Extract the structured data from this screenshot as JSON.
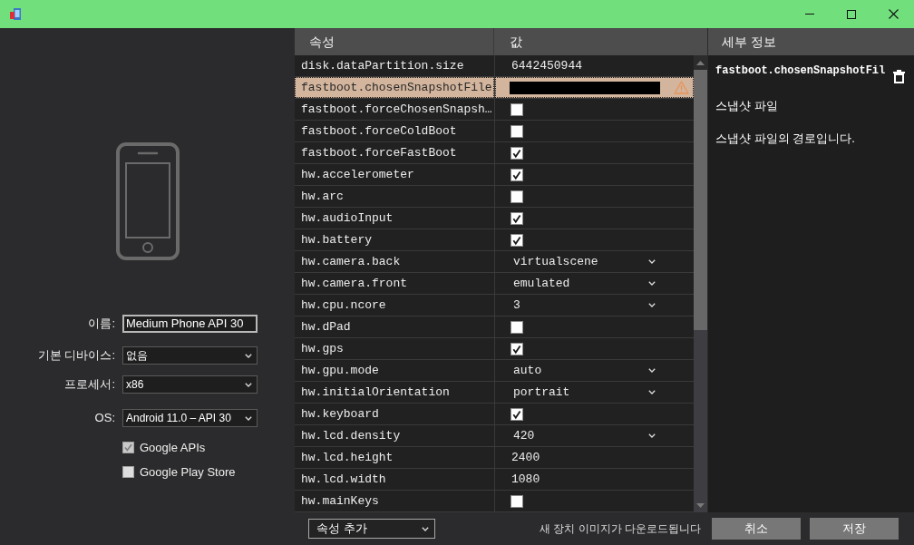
{
  "device_form": {
    "fields": [
      {
        "kind": "text",
        "label": "이름:",
        "value": "Medium Phone API 30"
      },
      {
        "kind": "select",
        "label": "기본 디바이스:",
        "value": "없음"
      },
      {
        "kind": "select",
        "label": "프로세서:",
        "value": "x86"
      },
      {
        "kind": "select",
        "label": "OS:",
        "value": "Android 11.0 – API 30"
      }
    ],
    "options": [
      {
        "label": "Google APIs",
        "checked": true
      },
      {
        "label": "Google Play Store",
        "checked": false
      }
    ]
  },
  "properties": {
    "columns": [
      "속성",
      "값"
    ],
    "rows": [
      {
        "name": "disk.dataPartition.size",
        "kind": "text",
        "value": "6442450944",
        "selected": false,
        "warning": false
      },
      {
        "name": "fastboot.chosenSnapshotFile",
        "kind": "input",
        "selected": true,
        "warning": true
      },
      {
        "name": "fastboot.forceChosenSnapsh…",
        "kind": "checkbox",
        "checked": false,
        "selected": false,
        "warning": false
      },
      {
        "name": "fastboot.forceColdBoot",
        "kind": "checkbox",
        "checked": false,
        "selected": false,
        "warning": false
      },
      {
        "name": "fastboot.forceFastBoot",
        "kind": "checkbox",
        "checked": true,
        "selected": false,
        "warning": false
      },
      {
        "name": "hw.accelerometer",
        "kind": "checkbox",
        "checked": true,
        "selected": false,
        "warning": false
      },
      {
        "name": "hw.arc",
        "kind": "checkbox",
        "checked": false,
        "selected": false,
        "warning": false
      },
      {
        "name": "hw.audioInput",
        "kind": "checkbox",
        "checked": true,
        "selected": false,
        "warning": false
      },
      {
        "name": "hw.battery",
        "kind": "checkbox",
        "checked": true,
        "selected": false,
        "warning": false
      },
      {
        "name": "hw.camera.back",
        "kind": "select",
        "value": "virtualscene",
        "selected": false,
        "warning": false
      },
      {
        "name": "hw.camera.front",
        "kind": "select",
        "value": "emulated",
        "selected": false,
        "warning": false
      },
      {
        "name": "hw.cpu.ncore",
        "kind": "select",
        "value": "3",
        "selected": false,
        "warning": false
      },
      {
        "name": "hw.dPad",
        "kind": "checkbox",
        "checked": false,
        "selected": false,
        "warning": false
      },
      {
        "name": "hw.gps",
        "kind": "checkbox",
        "checked": true,
        "selected": false,
        "warning": false
      },
      {
        "name": "hw.gpu.mode",
        "kind": "select",
        "value": "auto",
        "selected": false,
        "warning": false
      },
      {
        "name": "hw.initialOrientation",
        "kind": "select",
        "value": "portrait",
        "selected": false,
        "warning": false
      },
      {
        "name": "hw.keyboard",
        "kind": "checkbox",
        "checked": true,
        "selected": false,
        "warning": false
      },
      {
        "name": "hw.lcd.density",
        "kind": "select",
        "value": "420",
        "selected": false,
        "warning": false
      },
      {
        "name": "hw.lcd.height",
        "kind": "text",
        "value": "2400",
        "selected": false,
        "warning": false
      },
      {
        "name": "hw.lcd.width",
        "kind": "text",
        "value": "1080",
        "selected": false,
        "warning": false
      },
      {
        "name": "hw.mainKeys",
        "kind": "checkbox",
        "checked": false,
        "selected": false,
        "warning": false
      }
    ]
  },
  "details": {
    "title": "세부 정보",
    "property": "fastboot.chosenSnapshotFil",
    "label": "스냅샷 파일",
    "description": "스냅샷 파일의 경로입니다."
  },
  "footer": {
    "add_property": "속성 추가",
    "status": "새 장치 이미지가 다운로드됩니다",
    "buttons": [
      "취소",
      "저장"
    ]
  }
}
